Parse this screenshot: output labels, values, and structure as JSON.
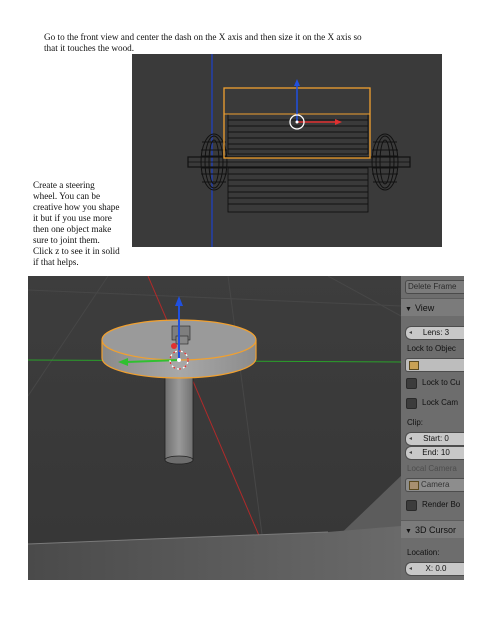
{
  "instructions": {
    "line1": "Go to the front view and center the dash on the X axis and then size it on the X axis so",
    "line2": "that it touches the wood.",
    "steering_lines": [
      "Create a steering",
      "wheel. You can be",
      "creative how you shape",
      "it but if you use more",
      "then one object make",
      "sure to joint them.",
      "Click z to see it in solid",
      "if that helps."
    ]
  },
  "panel": {
    "delete_frame": "Delete Frame",
    "view_header": "View",
    "lens": "Lens: 3",
    "lock_to_object": "Lock to Objec",
    "lock_to_cursor": "Lock to Cu",
    "lock_camera": "Lock Cam",
    "clip_label": "Clip:",
    "clip_start": "Start: 0",
    "clip_end": "End: 10",
    "local_camera": "Local Camera",
    "camera_field": "Camera",
    "render_border": "Render Bo",
    "cursor_header": "3D Cursor",
    "location_label": "Location:",
    "x_field": "X: 0.0"
  },
  "colors": {
    "selection": "#f0a030",
    "axis_x": "#e03030",
    "axis_y": "#30c030",
    "axis_z": "#2050e0",
    "front_view_bg": "#3a3a3a",
    "viewport_bg": "#3b3b3b",
    "panel_bg": "#6d6d6d"
  },
  "icons": {
    "manipulator": "transform-widget-icon",
    "cursor": "3d-cursor-icon",
    "collapse": "triangle-down-icon"
  }
}
